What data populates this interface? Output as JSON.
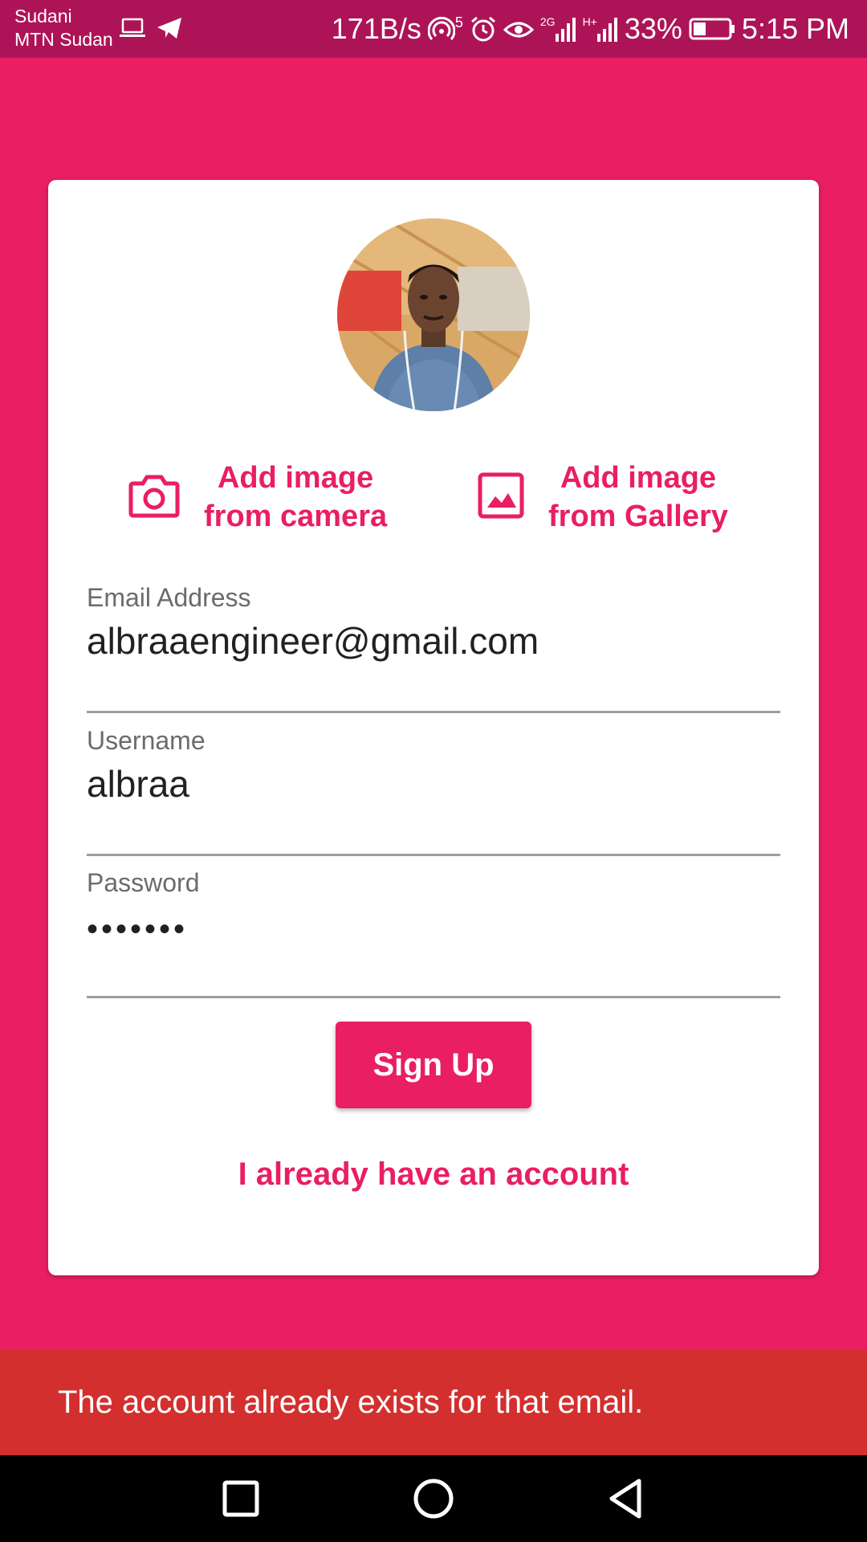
{
  "status_bar": {
    "carrier_line1": "Sudani",
    "carrier_line2": "MTN Sudan",
    "net_speed": "171B/s",
    "hotspot_count": "5",
    "signal_label_1": "2G",
    "signal_label_2": "H+",
    "battery": "33%",
    "time": "5:15 PM",
    "left_icons": [
      "laptop-icon",
      "telegram-icon"
    ],
    "right_icons": [
      "hotspot-icon",
      "alarm-icon",
      "eye-icon",
      "signal-icon",
      "signal-icon",
      "battery-icon"
    ]
  },
  "profile": {
    "avatar_icon": "profile-photo"
  },
  "add_image": {
    "camera_line1": "Add image",
    "camera_line2": "from camera",
    "camera_icon": "camera-icon",
    "gallery_line1": "Add image",
    "gallery_line2": "from Gallery",
    "gallery_icon": "image-icon"
  },
  "form": {
    "email_label": "Email Address",
    "email_value": "albraaengineer@gmail.com",
    "username_label": "Username",
    "username_value": "albraa",
    "password_label": "Password",
    "password_value": "•••••••",
    "signup_label": "Sign Up",
    "login_link": "I already have an account"
  },
  "snackbar": {
    "message": "The account already exists for that email."
  },
  "nav_bar": {
    "icons": [
      "recent-apps-icon",
      "home-icon",
      "back-icon"
    ]
  },
  "colors": {
    "primary": "#e91e63",
    "status_bar": "#ad1457",
    "snackbar": "#d32f2f",
    "card": "#ffffff"
  }
}
